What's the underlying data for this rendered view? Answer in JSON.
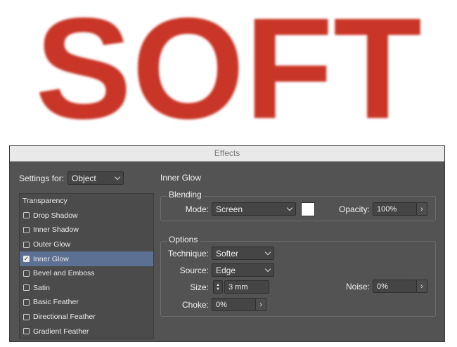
{
  "hero": {
    "text": "SOFT",
    "color": "#c93426"
  },
  "dialog": {
    "title": "Effects",
    "settings_for_label": "Settings for:",
    "settings_for_value": "Object",
    "section_title": "Inner Glow",
    "sidebar": {
      "header": "Transparency",
      "items": [
        {
          "label": "Drop Shadow",
          "checked": false
        },
        {
          "label": "Inner Shadow",
          "checked": false
        },
        {
          "label": "Outer Glow",
          "checked": false
        },
        {
          "label": "Inner Glow",
          "checked": true,
          "selected": true
        },
        {
          "label": "Bevel and Emboss",
          "checked": false
        },
        {
          "label": "Satin",
          "checked": false
        },
        {
          "label": "Basic Feather",
          "checked": false
        },
        {
          "label": "Directional Feather",
          "checked": false
        },
        {
          "label": "Gradient Feather",
          "checked": false
        }
      ]
    },
    "blending": {
      "legend": "Blending",
      "mode_label": "Mode:",
      "mode_value": "Screen",
      "glow_color": "#ffffff",
      "opacity_label": "Opacity:",
      "opacity_value": "100%"
    },
    "options": {
      "legend": "Options",
      "technique_label": "Technique:",
      "technique_value": "Softer",
      "source_label": "Source:",
      "source_value": "Edge",
      "size_label": "Size:",
      "size_value": "3 mm",
      "choke_label": "Choke:",
      "choke_value": "0%",
      "noise_label": "Noise:",
      "noise_value": "0%"
    }
  }
}
